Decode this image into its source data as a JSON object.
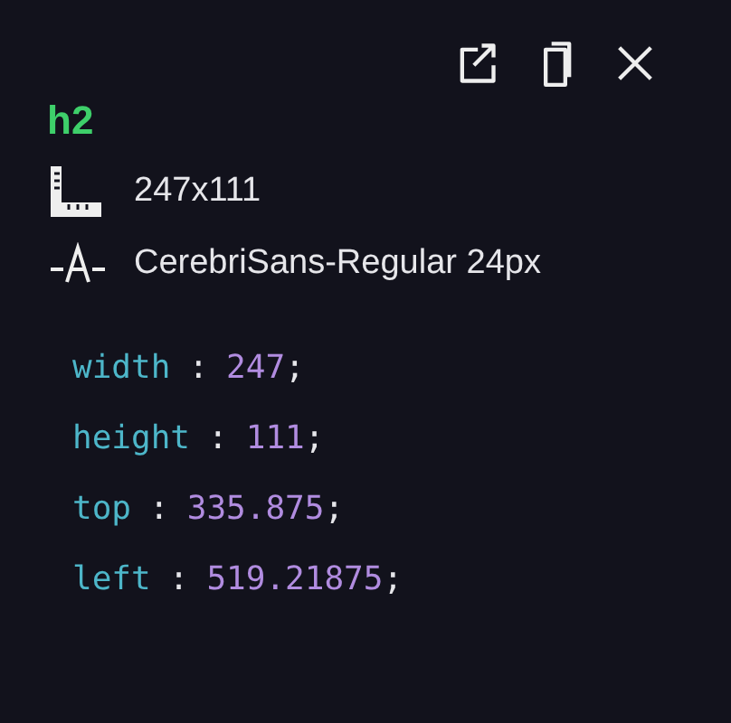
{
  "element": {
    "tag": "h2",
    "size": "247x111",
    "font": "CerebriSans-Regular 24px"
  },
  "css": [
    {
      "property": "width",
      "separator": ":",
      "value": "247",
      "terminator": ";"
    },
    {
      "property": "height",
      "separator": ":",
      "value": "111",
      "terminator": ";"
    },
    {
      "property": "top",
      "separator": ":",
      "value": "335.875",
      "terminator": ";"
    },
    {
      "property": "left",
      "separator": ":",
      "value": "519.21875",
      "terminator": ";"
    }
  ]
}
